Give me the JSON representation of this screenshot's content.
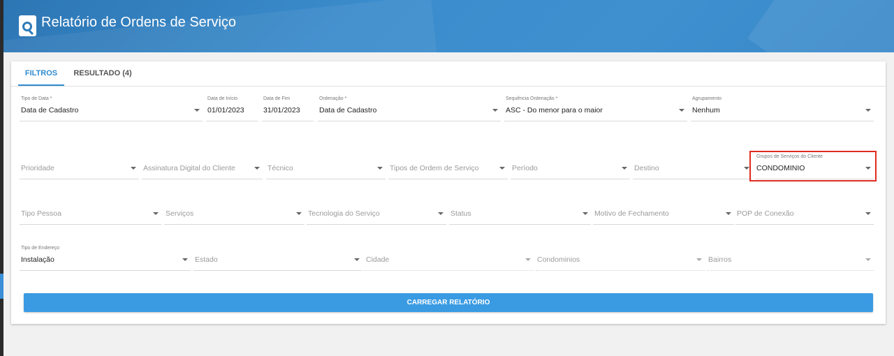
{
  "header": {
    "title": "Relatório de Ordens de Serviço",
    "logo_icon": "magnifier-document-icon"
  },
  "tabs": [
    {
      "label": "FILTROS",
      "active": true
    },
    {
      "label": "RESULTADO (4)",
      "active": false
    }
  ],
  "row1": {
    "tipo_data": {
      "label": "Tipo de Data *",
      "value": "Data de Cadastro"
    },
    "data_inicio": {
      "label": "Data de Início",
      "value": "01/01/2023"
    },
    "data_fim": {
      "label": "Data de Fim",
      "value": "31/01/2023"
    },
    "ordenacao": {
      "label": "Ordenação *",
      "value": "Data de Cadastro"
    },
    "sequencia": {
      "label": "Sequência Ordenação *",
      "value": "ASC - Do menor para o maior"
    },
    "agrupamento": {
      "label": "Agrupamento",
      "value": "Nenhum"
    }
  },
  "row2": {
    "prioridade": {
      "placeholder": "Prioridade"
    },
    "assinatura": {
      "placeholder": "Assinatura Digital do Cliente"
    },
    "tecnico": {
      "placeholder": "Técnico"
    },
    "tipos_os": {
      "placeholder": "Tipos de Ordem de Serviço"
    },
    "periodo": {
      "placeholder": "Período"
    },
    "destino": {
      "placeholder": "Destino"
    },
    "grupos": {
      "label": "Grupos de Serviços do Cliente",
      "value": "CONDOMINIO"
    }
  },
  "row3": {
    "tipo_pessoa": {
      "placeholder": "Tipo Pessoa"
    },
    "servicos": {
      "placeholder": "Serviços"
    },
    "tecnologia": {
      "placeholder": "Tecnologia do Serviço"
    },
    "status": {
      "placeholder": "Status"
    },
    "motivo": {
      "placeholder": "Motivo de Fechamento"
    },
    "pop": {
      "placeholder": "POP de Conexão"
    }
  },
  "row4": {
    "tipo_endereco": {
      "label": "Tipo de Endereço",
      "value": "Instalação"
    },
    "estado": {
      "placeholder": "Estado"
    },
    "cidade": {
      "placeholder": "Cidade"
    },
    "condominios": {
      "placeholder": "Condominios"
    },
    "bairros": {
      "placeholder": "Bairros"
    }
  },
  "button": {
    "label": "CARREGAR RELATÓRIO"
  },
  "colors": {
    "header": "#3b8ccc",
    "accent": "#2f8bd0",
    "button": "#3a9be3",
    "highlight": "#e02b20"
  }
}
